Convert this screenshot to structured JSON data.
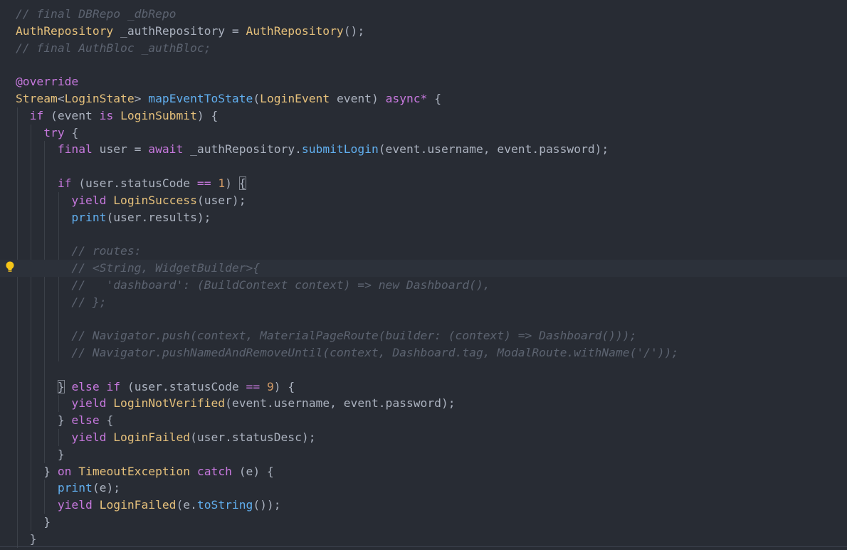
{
  "editor": {
    "colors": {
      "background": "#282c34",
      "comment": "#5c6370",
      "keyword": "#c678dd",
      "type": "#e5c07b",
      "function": "#61afef",
      "number": "#d19a66",
      "plain": "#abb2bf"
    },
    "gutter_icon": "lightbulb-icon",
    "current_line_index": 15,
    "lines": [
      {
        "tokens": [
          {
            "t": "// final DBRepo _dbRepo",
            "k": "comment"
          }
        ]
      },
      {
        "tokens": [
          {
            "t": "AuthRepository",
            "k": "type"
          },
          {
            "t": " _authRepository = ",
            "k": "plain"
          },
          {
            "t": "AuthRepository",
            "k": "type"
          },
          {
            "t": "();",
            "k": "plain"
          }
        ]
      },
      {
        "tokens": [
          {
            "t": "// final AuthBloc _authBloc;",
            "k": "comment"
          }
        ]
      },
      {
        "tokens": []
      },
      {
        "tokens": [
          {
            "t": "@override",
            "k": "keyword"
          }
        ]
      },
      {
        "tokens": [
          {
            "t": "Stream",
            "k": "type"
          },
          {
            "t": "<",
            "k": "plain"
          },
          {
            "t": "LoginState",
            "k": "type"
          },
          {
            "t": "> ",
            "k": "plain"
          },
          {
            "t": "mapEventToState",
            "k": "function"
          },
          {
            "t": "(",
            "k": "plain"
          },
          {
            "t": "LoginEvent",
            "k": "type"
          },
          {
            "t": " event) ",
            "k": "plain"
          },
          {
            "t": "async*",
            "k": "keyword"
          },
          {
            "t": " {",
            "k": "plain"
          }
        ]
      },
      {
        "tokens": [
          {
            "t": "  ",
            "k": "plain"
          },
          {
            "t": "if",
            "k": "keyword"
          },
          {
            "t": " (event ",
            "k": "plain"
          },
          {
            "t": "is",
            "k": "keyword"
          },
          {
            "t": " ",
            "k": "plain"
          },
          {
            "t": "LoginSubmit",
            "k": "type"
          },
          {
            "t": ") {",
            "k": "plain"
          }
        ]
      },
      {
        "tokens": [
          {
            "t": "    ",
            "k": "plain"
          },
          {
            "t": "try",
            "k": "keyword"
          },
          {
            "t": " {",
            "k": "plain"
          }
        ]
      },
      {
        "tokens": [
          {
            "t": "      ",
            "k": "plain"
          },
          {
            "t": "final",
            "k": "keyword"
          },
          {
            "t": " user = ",
            "k": "plain"
          },
          {
            "t": "await",
            "k": "keyword"
          },
          {
            "t": " _authRepository.",
            "k": "plain"
          },
          {
            "t": "submitLogin",
            "k": "function"
          },
          {
            "t": "(event.username, event.password);",
            "k": "plain"
          }
        ]
      },
      {
        "tokens": []
      },
      {
        "tokens": [
          {
            "t": "      ",
            "k": "plain"
          },
          {
            "t": "if",
            "k": "keyword"
          },
          {
            "t": " (user.statusCode ",
            "k": "plain"
          },
          {
            "t": "==",
            "k": "keyword"
          },
          {
            "t": " ",
            "k": "plain"
          },
          {
            "t": "1",
            "k": "number"
          },
          {
            "t": ") ",
            "k": "plain"
          },
          {
            "t": "{",
            "k": "bracket"
          }
        ]
      },
      {
        "tokens": [
          {
            "t": "        ",
            "k": "plain"
          },
          {
            "t": "yield",
            "k": "keyword"
          },
          {
            "t": " ",
            "k": "plain"
          },
          {
            "t": "LoginSuccess",
            "k": "type"
          },
          {
            "t": "(user);",
            "k": "plain"
          }
        ]
      },
      {
        "tokens": [
          {
            "t": "        ",
            "k": "plain"
          },
          {
            "t": "print",
            "k": "function"
          },
          {
            "t": "(user.results);",
            "k": "plain"
          }
        ]
      },
      {
        "tokens": []
      },
      {
        "tokens": [
          {
            "t": "        ",
            "k": "plain"
          },
          {
            "t": "// routes:",
            "k": "comment"
          }
        ]
      },
      {
        "tokens": [
          {
            "t": "        ",
            "k": "plain"
          },
          {
            "t": "// <String, WidgetBuilder>{",
            "k": "comment"
          }
        ]
      },
      {
        "tokens": [
          {
            "t": "        ",
            "k": "plain"
          },
          {
            "t": "//   'dashboard': (BuildContext context) => new Dashboard(),",
            "k": "comment"
          }
        ]
      },
      {
        "tokens": [
          {
            "t": "        ",
            "k": "plain"
          },
          {
            "t": "// };",
            "k": "comment"
          }
        ]
      },
      {
        "tokens": []
      },
      {
        "tokens": [
          {
            "t": "        ",
            "k": "plain"
          },
          {
            "t": "// Navigator.push(context, MaterialPageRoute(builder: (context) => Dashboard()));",
            "k": "comment"
          }
        ]
      },
      {
        "tokens": [
          {
            "t": "        ",
            "k": "plain"
          },
          {
            "t": "// Navigator.pushNamedAndRemoveUntil(context, Dashboard.tag, ModalRoute.withName('/'));",
            "k": "comment"
          }
        ]
      },
      {
        "tokens": []
      },
      {
        "tokens": [
          {
            "t": "      ",
            "k": "plain"
          },
          {
            "t": "}",
            "k": "bracket"
          },
          {
            "t": " ",
            "k": "plain"
          },
          {
            "t": "else",
            "k": "keyword"
          },
          {
            "t": " ",
            "k": "plain"
          },
          {
            "t": "if",
            "k": "keyword"
          },
          {
            "t": " (user.statusCode ",
            "k": "plain"
          },
          {
            "t": "==",
            "k": "keyword"
          },
          {
            "t": " ",
            "k": "plain"
          },
          {
            "t": "9",
            "k": "number"
          },
          {
            "t": ") {",
            "k": "plain"
          }
        ]
      },
      {
        "tokens": [
          {
            "t": "        ",
            "k": "plain"
          },
          {
            "t": "yield",
            "k": "keyword"
          },
          {
            "t": " ",
            "k": "plain"
          },
          {
            "t": "LoginNotVerified",
            "k": "type"
          },
          {
            "t": "(event.username, event.password);",
            "k": "plain"
          }
        ]
      },
      {
        "tokens": [
          {
            "t": "      } ",
            "k": "plain"
          },
          {
            "t": "else",
            "k": "keyword"
          },
          {
            "t": " {",
            "k": "plain"
          }
        ]
      },
      {
        "tokens": [
          {
            "t": "        ",
            "k": "plain"
          },
          {
            "t": "yield",
            "k": "keyword"
          },
          {
            "t": " ",
            "k": "plain"
          },
          {
            "t": "LoginFailed",
            "k": "type"
          },
          {
            "t": "(user.statusDesc);",
            "k": "plain"
          }
        ]
      },
      {
        "tokens": [
          {
            "t": "      }",
            "k": "plain"
          }
        ]
      },
      {
        "tokens": [
          {
            "t": "    } ",
            "k": "plain"
          },
          {
            "t": "on",
            "k": "keyword"
          },
          {
            "t": " ",
            "k": "plain"
          },
          {
            "t": "TimeoutException",
            "k": "type"
          },
          {
            "t": " ",
            "k": "plain"
          },
          {
            "t": "catch",
            "k": "keyword"
          },
          {
            "t": " (e) {",
            "k": "plain"
          }
        ]
      },
      {
        "tokens": [
          {
            "t": "      ",
            "k": "plain"
          },
          {
            "t": "print",
            "k": "function"
          },
          {
            "t": "(e);",
            "k": "plain"
          }
        ]
      },
      {
        "tokens": [
          {
            "t": "      ",
            "k": "plain"
          },
          {
            "t": "yield",
            "k": "keyword"
          },
          {
            "t": " ",
            "k": "plain"
          },
          {
            "t": "LoginFailed",
            "k": "type"
          },
          {
            "t": "(e.",
            "k": "plain"
          },
          {
            "t": "toString",
            "k": "function"
          },
          {
            "t": "());",
            "k": "plain"
          }
        ]
      },
      {
        "tokens": [
          {
            "t": "    }",
            "k": "plain"
          }
        ]
      },
      {
        "tokens": [
          {
            "t": "  }",
            "k": "plain"
          }
        ]
      }
    ]
  }
}
